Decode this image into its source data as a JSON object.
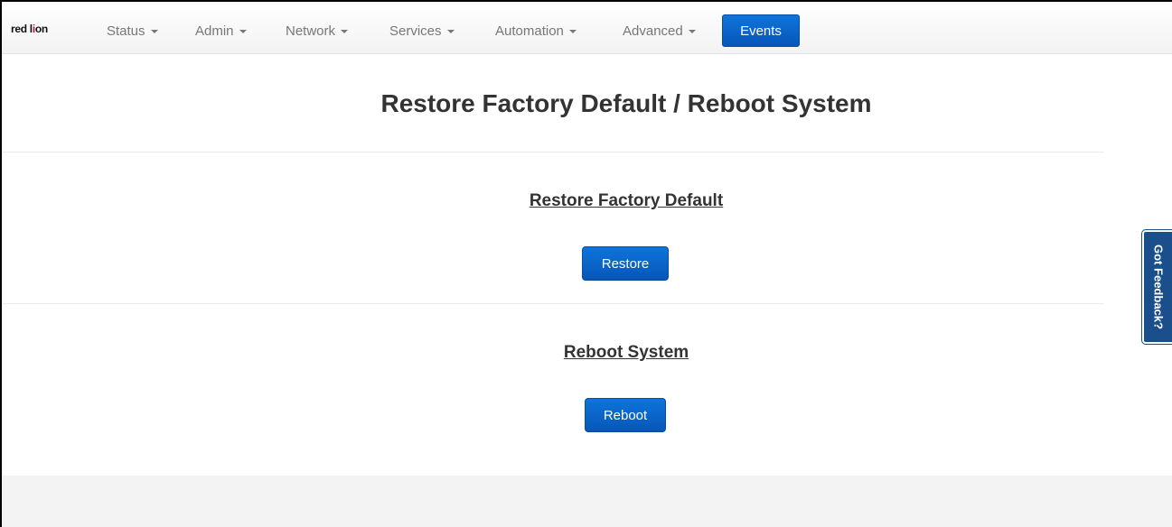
{
  "navbar": {
    "brand": {
      "pre": "red l",
      "o": "i",
      "post": "on"
    },
    "items": [
      {
        "label": "Status"
      },
      {
        "label": "Admin"
      },
      {
        "label": "Network"
      },
      {
        "label": "Services"
      },
      {
        "label": "Automation"
      },
      {
        "label": "Advanced"
      }
    ],
    "events_label": "Events"
  },
  "page": {
    "title": "Restore Factory Default / Reboot System",
    "sections": [
      {
        "title": "Restore Factory Default",
        "button_label": "Restore"
      },
      {
        "title": "Reboot System",
        "button_label": "Reboot"
      }
    ]
  },
  "feedback_tab": {
    "label": "Got Feedback?"
  },
  "colors": {
    "primary_button": "#0b66cc",
    "feedback_tab": "#1a4f8b",
    "brand_accent": "#c8102e"
  },
  "icons": [
    "caret-down-icon"
  ]
}
